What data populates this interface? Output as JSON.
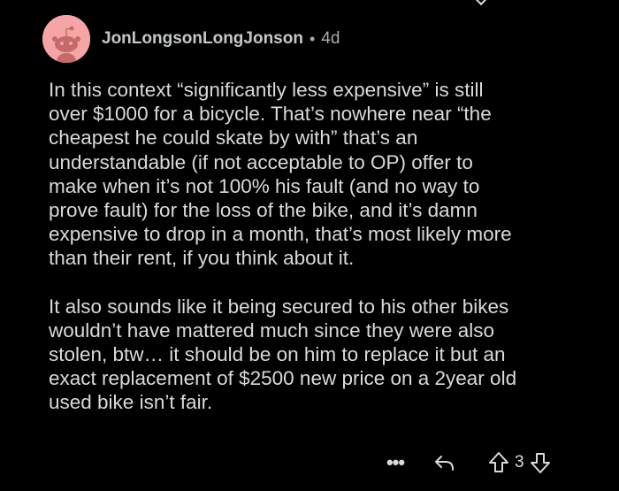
{
  "comment": {
    "author": "JonLongsonLongJonson",
    "separator": "•",
    "age": "4d",
    "paragraphs": [
      "In this context “significantly less expensive” is still\nover $1000 for a bicycle. That’s nowhere near “the\ncheapest he could skate by with” that’s an\nunderstandable (if not acceptable to OP) offer to\nmake when it’s not 100% his fault (and no way to\nprove fault) for the loss of the bike, and it’s damn\nexpensive to drop in a month, that’s most likely more\nthan their rent, if you think about it.",
      "It also sounds like it being secured to his other bikes\nwouldn’t have mattered much since they were also\nstolen, btw… it should be on him to replace it but an\nexact replacement of $2500 new price on a 2year old\nused bike isn’t fair."
    ],
    "actions": {
      "more_label": "•••",
      "reply_icon": "reply-arrow-icon",
      "upvote_icon": "upvote-arrow-icon",
      "vote_count": "3",
      "downvote_icon": "downvote-arrow-icon"
    }
  },
  "colors": {
    "background": "#000000",
    "text": "#d7dadc",
    "meta_text": "#a8abad",
    "avatar_bg": "#f5a5a5"
  }
}
